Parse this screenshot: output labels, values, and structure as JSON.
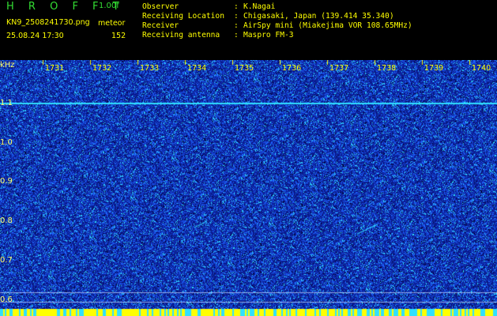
{
  "app": {
    "title": "H R O F F T",
    "version": "1.00f",
    "filename": "KN9_2508241730.png",
    "meteor_label": "meteor",
    "datetime": "25.08.24 17:30",
    "meteor_count": "152"
  },
  "info": [
    {
      "key": "Observer",
      "value": "K.Nagai"
    },
    {
      "key": "Receiving Location",
      "value": "Chigasaki, Japan (139.414 35.340)"
    },
    {
      "key": "Receiver",
      "value": "AirSpy mini (Miakejima VOR 108.65MHz)"
    },
    {
      "key": "Receiving antenna",
      "value": "Maspro FM-3"
    }
  ],
  "spectrogram": {
    "y_unit": "kHz",
    "y_ticks": [
      "1.1",
      "1.0",
      "0.9",
      "0.8",
      "0.7",
      "0.6"
    ],
    "time_ticks": [
      "1731",
      "1732",
      "1733",
      "1734",
      "1735",
      "1736",
      "1737",
      "1738",
      "1739",
      "1740"
    ],
    "colors": {
      "background": "#0a1a8c",
      "noise": "#1e64ff",
      "signal": "#30e0ff",
      "label": "#ffff00"
    }
  }
}
